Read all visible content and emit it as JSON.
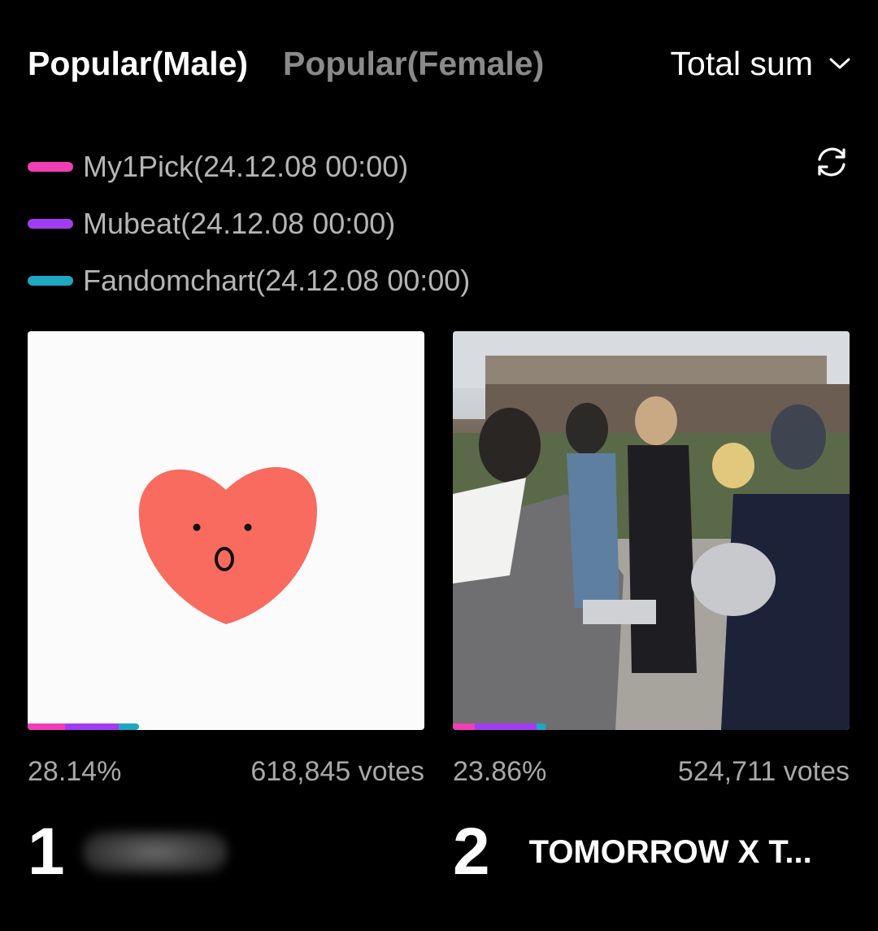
{
  "tabs": [
    {
      "label": "Popular(Male)",
      "active": true
    },
    {
      "label": "Popular(Female)",
      "active": false
    }
  ],
  "sort": {
    "label": "Total sum",
    "icon": "chevron-down-icon"
  },
  "legend": [
    {
      "label": "My1Pick(24.12.08 00:00)",
      "color": "#f03eb5"
    },
    {
      "label": "Mubeat(24.12.08 00:00)",
      "color": "#a23cf2"
    },
    {
      "label": "Fandomchart(24.12.08 00:00)",
      "color": "#1fa6c2"
    }
  ],
  "refresh_icon": "refresh-icon",
  "cards": [
    {
      "rank": "1",
      "name": "",
      "percent": "28.14%",
      "votes": "618,845 votes",
      "image": "surprised-heart-illustration",
      "shares": {
        "my1pick": 0.095,
        "mubeat": 0.135,
        "fandomchart": 0.051
      }
    },
    {
      "rank": "2",
      "name": "TOMORROW X T...",
      "percent": "23.86%",
      "votes": "524,711 votes",
      "image": "group-photo",
      "shares": {
        "my1pick": 0.055,
        "mubeat": 0.155,
        "fandomchart": 0.025
      }
    }
  ]
}
